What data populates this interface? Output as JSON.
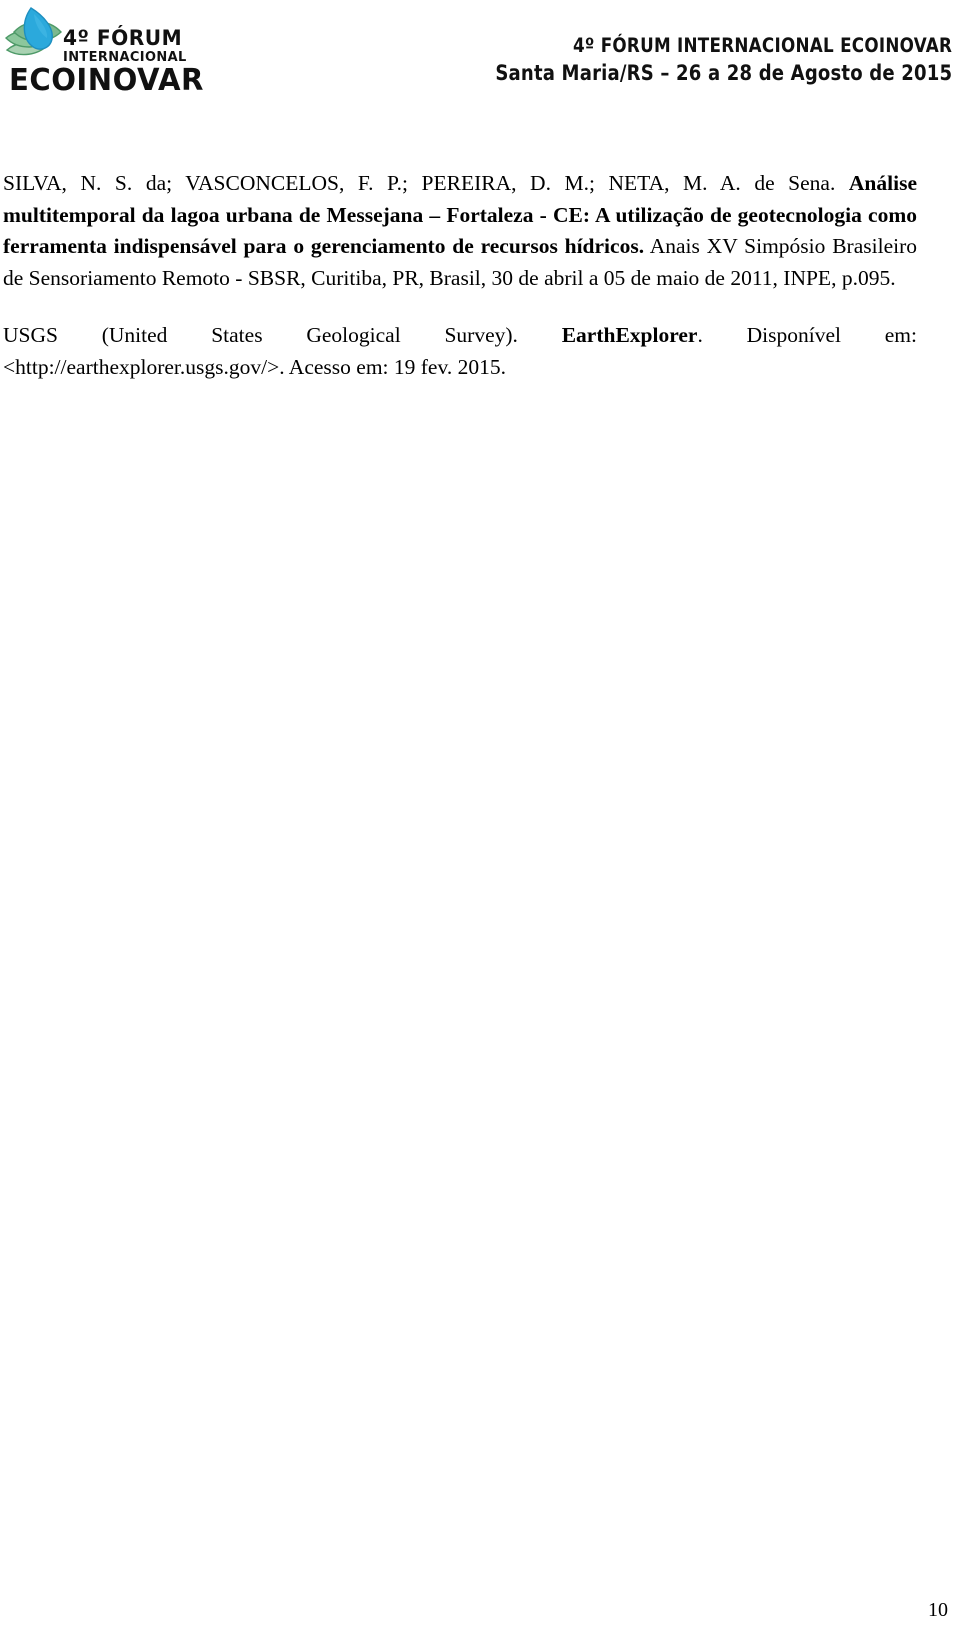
{
  "header": {
    "logo": {
      "mark_name": "ecoinovar-leaf-logo",
      "wordmark_line1": "4º FÓRUM",
      "wordmark_line2": "INTERNACIONAL",
      "wordmark_line3": "ECOINOVAR",
      "colors": {
        "leaf_blue": "#2BA9DC",
        "leaf_blue_dark": "#1E8FC0",
        "leaf_green": "#7CB98F",
        "leaf_green_light": "#A9D2B2",
        "leaf_green_dark": "#4E9A68",
        "wordmark_black": "#111111"
      }
    },
    "event_title_line1": "4º FÓRUM INTERNACIONAL ECOINOVAR",
    "event_title_line2": "Santa Maria/RS – 26 a 28 de Agosto de 2015"
  },
  "references": [
    {
      "id": "ref-silva-2011",
      "authors": "SILVA, N. S. da; VASCONCELOS, F. P.; PEREIRA, D. M.; NETA, M. A. de Sena. ",
      "title": "Análise multitemporal da lagoa urbana de Messejana – Fortaleza - CE: A utilização de geotecnologia como ferramenta indispensável para o gerenciamento de recursos hídricos.",
      "source": " Anais XV Simpósio Brasileiro de Sensoriamento Remoto - SBSR, Curitiba, PR, Brasil, 30 de abril a 05 de maio de 2011, INPE, p.095."
    },
    {
      "id": "ref-usgs",
      "authors": "USGS (United States Geological Survey). ",
      "title": "EarthExplorer",
      "source": ". Disponível em: <http://earthexplorer.usgs.gov/>. Acesso em: 19 fev. 2015."
    }
  ],
  "footer": {
    "page_number": "10"
  }
}
